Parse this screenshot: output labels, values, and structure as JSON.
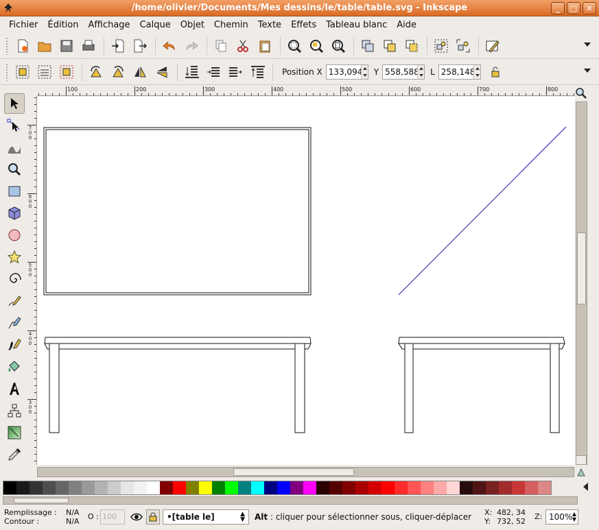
{
  "window": {
    "title": "/home/olivier/Documents/Mes dessins/le/table/table.svg - Inkscape",
    "buttons": [
      "_",
      "□",
      "✕"
    ]
  },
  "menu": [
    "Fichier",
    "Édition",
    "Affichage",
    "Calque",
    "Objet",
    "Chemin",
    "Texte",
    "Effets",
    "Tableau blanc",
    "Aide"
  ],
  "toolbar_commands": {
    "icons": [
      "new-document-icon",
      "open-folder-icon",
      "save-icon",
      "print-icon",
      "import-icon",
      "export-icon",
      "undo-icon",
      "redo-icon",
      "copy-icon",
      "cut-icon",
      "paste-icon",
      "zoom-selection-icon",
      "zoom-drawing-icon",
      "zoom-page-icon",
      "duplicate-icon",
      "clone-icon",
      "unlink-clone-icon",
      "group-icon",
      "ungroup-icon",
      "fill-stroke-icon"
    ]
  },
  "toolbar_selector": {
    "position_label": "Position X",
    "x_value": "133,094",
    "y_label": "Y",
    "y_value": "558,588",
    "w_label": "L",
    "w_value": "258,148"
  },
  "rulers": {
    "horizontal": [
      "100",
      "200",
      "300",
      "400",
      "500",
      "600",
      "700",
      "800"
    ],
    "vertical": [
      "700",
      "600",
      "500",
      "400",
      "300"
    ]
  },
  "palette": {
    "colors": [
      "#000000",
      "#1a1a1a",
      "#333333",
      "#4d4d4d",
      "#666666",
      "#808080",
      "#999999",
      "#b3b3b3",
      "#cccccc",
      "#e6e6e6",
      "#f2f2f2",
      "#ffffff",
      "#800000",
      "#ff0000",
      "#808000",
      "#ffff00",
      "#008000",
      "#00ff00",
      "#008080",
      "#00ffff",
      "#000080",
      "#0000ff",
      "#800080",
      "#ff00ff",
      "#2b0000",
      "#550000",
      "#800000",
      "#aa0000",
      "#d40000",
      "#ff0000",
      "#ff2a2a",
      "#ff5555",
      "#ff8080",
      "#ffaaaa",
      "#ffd5d5",
      "#280b0b",
      "#501616",
      "#782121",
      "#a02c2c",
      "#c83737",
      "#d35f5f",
      "#de8787"
    ]
  },
  "status": {
    "fill_label": "Remplissage :",
    "stroke_label": "Contour :",
    "fill_value": "N/A",
    "stroke_value": "N/A",
    "opacity_label": "O :",
    "opacity_value": "100",
    "layer": "•[table le]",
    "message_key": "Alt",
    "message": " : cliquer pour sélectionner sous, cliquer-déplacer",
    "x_label": "X:",
    "y_label": "Y:",
    "x_value": "482, 34",
    "y_value": "732, 52",
    "zoom_label": "Z:",
    "zoom_value": "100%"
  },
  "colors": {
    "titlebar": "#e07a3a",
    "line_stroke": "#1a1aa6"
  }
}
